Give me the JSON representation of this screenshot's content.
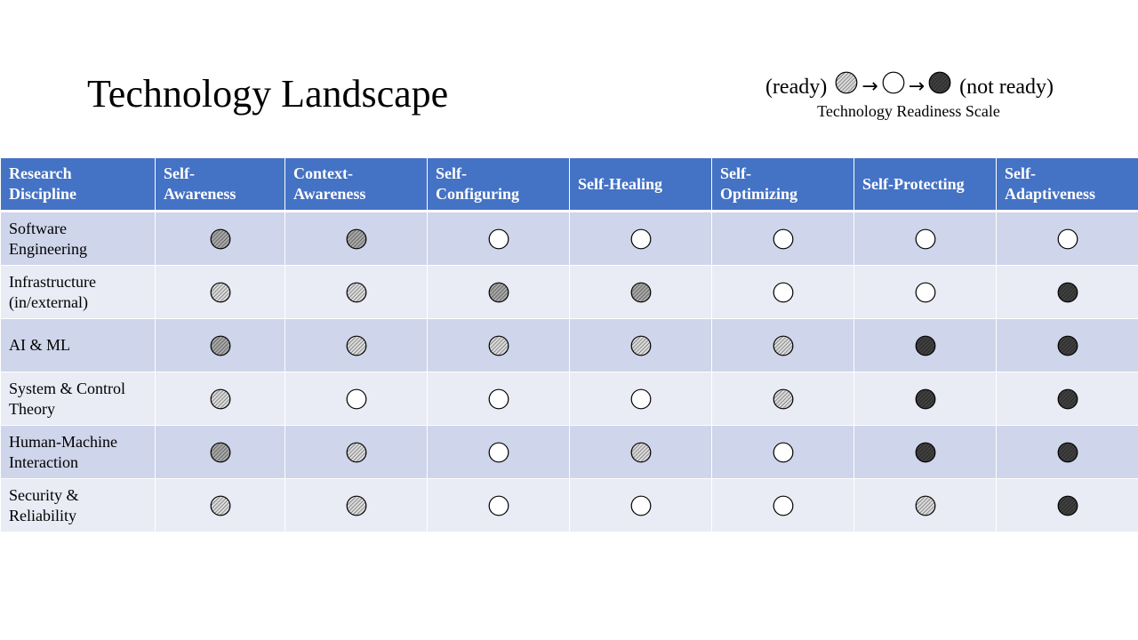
{
  "slide": {
    "title": "Technology Landscape"
  },
  "legend": {
    "ready_label": "(ready)",
    "not_ready_label": "(not ready)",
    "arrow": "→",
    "levels": [
      "light-hatched",
      "empty",
      "dark-hatched"
    ],
    "caption": "Technology Readiness Scale"
  },
  "colors": {
    "header_bg": "#4472c4",
    "row_odd": "#cfd5ea",
    "row_even": "#e9ebf5",
    "light_fill": "#d9d9d9",
    "mid_fill": "#a6a6a6",
    "dark_fill": "#404040"
  },
  "table": {
    "headers": [
      "Research Discipline",
      "Self-Awareness",
      "Context-Awareness",
      "Self-Configuring",
      "Self-Healing",
      "Self-Optimizing",
      "Self-Protecting",
      "Self-Adaptiveness"
    ],
    "header_lines": [
      [
        "Research",
        "Discipline"
      ],
      [
        "Self-",
        "Awareness"
      ],
      [
        "Context-",
        "Awareness"
      ],
      [
        "Self-",
        "Configuring"
      ],
      [
        "Self-Healing"
      ],
      [
        "Self-",
        "Optimizing"
      ],
      [
        "Self-Protecting"
      ],
      [
        "Self-",
        "Adaptiveness"
      ]
    ],
    "rows": [
      {
        "discipline_lines": [
          "Software",
          "Engineering"
        ],
        "discipline": "Software Engineering",
        "ratings": [
          "medium",
          "medium",
          "empty",
          "empty",
          "empty",
          "empty",
          "empty"
        ]
      },
      {
        "discipline_lines": [
          "Infrastructure",
          "(in/external)"
        ],
        "discipline": "Infrastructure (in/external)",
        "ratings": [
          "light",
          "light",
          "medium",
          "medium",
          "empty",
          "empty",
          "dark"
        ]
      },
      {
        "discipline_lines": [
          "AI & ML"
        ],
        "discipline": "AI & ML",
        "ratings": [
          "medium",
          "light",
          "light",
          "light",
          "light",
          "dark",
          "dark"
        ]
      },
      {
        "discipline_lines": [
          "System & Control",
          "Theory"
        ],
        "discipline": "System & Control Theory",
        "ratings": [
          "light",
          "empty",
          "empty",
          "empty",
          "light",
          "dark",
          "dark"
        ]
      },
      {
        "discipline_lines": [
          "Human-Machine",
          "Interaction"
        ],
        "discipline": "Human-Machine Interaction",
        "ratings": [
          "medium",
          "light",
          "empty",
          "light",
          "empty",
          "dark",
          "dark"
        ]
      },
      {
        "discipline_lines": [
          "Security &",
          "Reliability"
        ],
        "discipline": "Security & Reliability",
        "ratings": [
          "light",
          "light",
          "empty",
          "empty",
          "empty",
          "light",
          "dark"
        ]
      }
    ]
  }
}
